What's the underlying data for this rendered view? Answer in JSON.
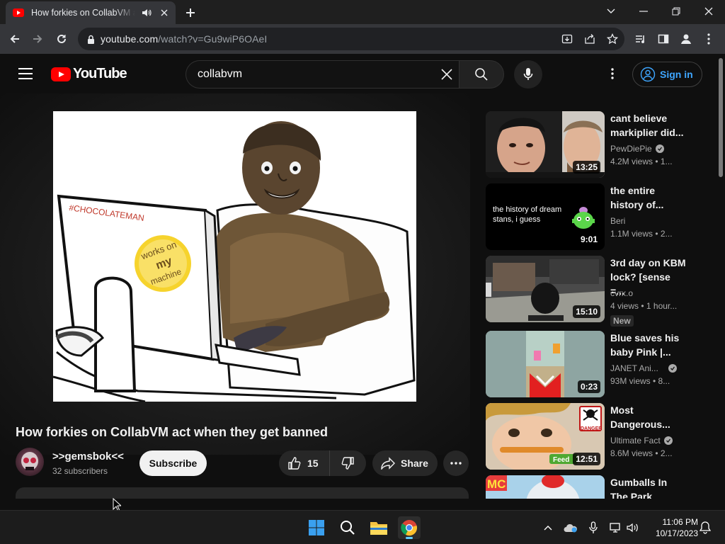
{
  "browser": {
    "tab_title": "How forkies on CollabVM act when they get banned - YouTube",
    "url_host": "youtube.com",
    "url_path": "/watch?v=Gu9wiP6OAeI"
  },
  "youtube": {
    "logo_text": "YouTube",
    "search_query": "collabvm",
    "signin_label": "Sign in",
    "video": {
      "title": "How forkies on CollabVM act when they get banned",
      "channel_name": ">>gemsbok<<",
      "subscribers": "32 subscribers",
      "subscribe_label": "Subscribe",
      "likes": "15",
      "share_label": "Share",
      "frame_caption": "#CHOCOLATEMAN",
      "sticker_text": [
        "works on",
        "my",
        "machine"
      ]
    },
    "recommendations": [
      {
        "title": "cant believe\nmarkiplier did...",
        "channel": "PewDiePie",
        "verified": true,
        "meta": "4.2M views  •  1...",
        "duration": "13:25"
      },
      {
        "title": "the entire\nhistory of...",
        "channel": "Beri",
        "verified": false,
        "meta": "1.1M views  •  2...",
        "duration": "9:01",
        "thumb_text": "the history of dream\nstans, i guess"
      },
      {
        "title": "3rd day on KBM\nlock? [sense =...",
        "channel": "cvrx.o",
        "verified": false,
        "meta": "4 views  •  1 hour...",
        "duration": "15:10",
        "badge": "New"
      },
      {
        "title": "Blue saves his\nbaby Pink |...",
        "channel": "JANET Ani...",
        "verified": true,
        "meta": "93M views  •  8...",
        "duration": "0:23"
      },
      {
        "title": "Most\nDangerous...",
        "channel": "Ultimate Fact",
        "verified": true,
        "meta": "8.6M views  •  2...",
        "duration": "12:51",
        "thumb_badge": "DANGER",
        "thumb_label": "Feed"
      },
      {
        "title": "Gumballs In\nThe Park",
        "channel": "",
        "verified": false,
        "meta": "",
        "duration": "",
        "thumb_text": "MC"
      }
    ]
  },
  "taskbar": {
    "time": "11:06 PM",
    "date": "10/17/2023"
  },
  "colors": {
    "accent_link": "#3ea6ff",
    "youtube_red": "#ff0000",
    "page_bg": "#0f0f0f"
  }
}
